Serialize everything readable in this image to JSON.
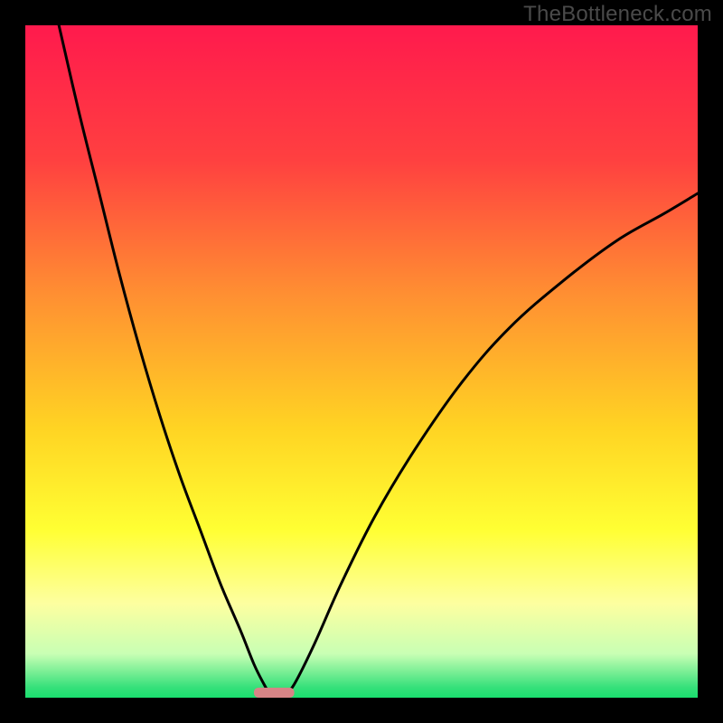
{
  "watermark": "TheBottleneck.com",
  "chart_data": {
    "type": "line",
    "title": "",
    "xlabel": "",
    "ylabel": "",
    "xlim": [
      0,
      100
    ],
    "ylim": [
      0,
      100
    ],
    "grid": false,
    "legend": false,
    "background_gradient": {
      "stops": [
        {
          "offset": 0.0,
          "color": "#ff1a4d"
        },
        {
          "offset": 0.2,
          "color": "#ff4040"
        },
        {
          "offset": 0.4,
          "color": "#ff8f32"
        },
        {
          "offset": 0.6,
          "color": "#ffd423"
        },
        {
          "offset": 0.75,
          "color": "#ffff33"
        },
        {
          "offset": 0.86,
          "color": "#fdffa0"
        },
        {
          "offset": 0.935,
          "color": "#c8ffb4"
        },
        {
          "offset": 0.985,
          "color": "#35e07a"
        },
        {
          "offset": 1.0,
          "color": "#1adf6e"
        }
      ]
    },
    "marker": {
      "x": 37,
      "y": 0,
      "w": 6,
      "h": 1.5,
      "color": "#d78486"
    },
    "series": [
      {
        "name": "left-branch",
        "x": [
          5.0,
          8.0,
          11.0,
          14.0,
          17.0,
          20.0,
          23.0,
          26.0,
          29.0,
          32.0,
          34.0,
          35.5,
          36.5
        ],
        "y": [
          100.0,
          87.0,
          75.0,
          63.0,
          52.0,
          42.0,
          33.0,
          25.0,
          17.0,
          10.0,
          5.0,
          2.0,
          0.3
        ]
      },
      {
        "name": "right-branch",
        "x": [
          38.5,
          40.0,
          43.0,
          47.0,
          52.0,
          58.0,
          65.0,
          72.0,
          80.0,
          88.0,
          95.0,
          100.0
        ],
        "y": [
          0.3,
          2.0,
          8.0,
          17.0,
          27.0,
          37.0,
          47.0,
          55.0,
          62.0,
          68.0,
          72.0,
          75.0
        ]
      }
    ]
  }
}
